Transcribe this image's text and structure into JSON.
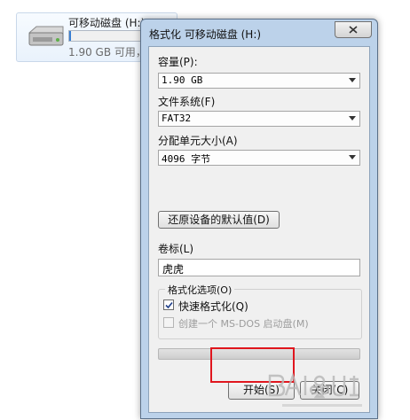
{
  "background": {
    "drive_tile": {
      "name": "可移动磁盘 (H:)",
      "free_text": "1.90 GB 可用，",
      "used_fraction": 0.02
    }
  },
  "dialog": {
    "title": "格式化 可移动磁盘 (H:)",
    "capacity": {
      "label": "容量(P):",
      "value": "1.90 GB"
    },
    "filesystem": {
      "label": "文件系统(F)",
      "value": "FAT32"
    },
    "allocation": {
      "label": "分配单元大小(A)",
      "value": "4096 字节"
    },
    "restore_defaults_label": "还原设备的默认值(D)",
    "volume_label": {
      "label": "卷标(L)",
      "value": "虎虎"
    },
    "options": {
      "title": "格式化选项(O)",
      "quick_format": {
        "label": "快速格式化(Q)",
        "checked": true
      },
      "msdos_boot": {
        "label": "创建一个 MS-DOS 启动盘(M)",
        "checked": false,
        "disabled": true
      }
    },
    "progress_fraction": 0,
    "start_label": "开始(S)",
    "close_label": "关闭(C)"
  },
  "colors": {
    "highlight": "#e0161e",
    "title_bar": "#bcd2ea",
    "progress_fill": "#3aa34a"
  },
  "icons": {
    "close": "close-x-icon",
    "dropdown": "chevron-down-icon",
    "check": "checkmark-icon",
    "drive": "removable-drive-icon"
  }
}
